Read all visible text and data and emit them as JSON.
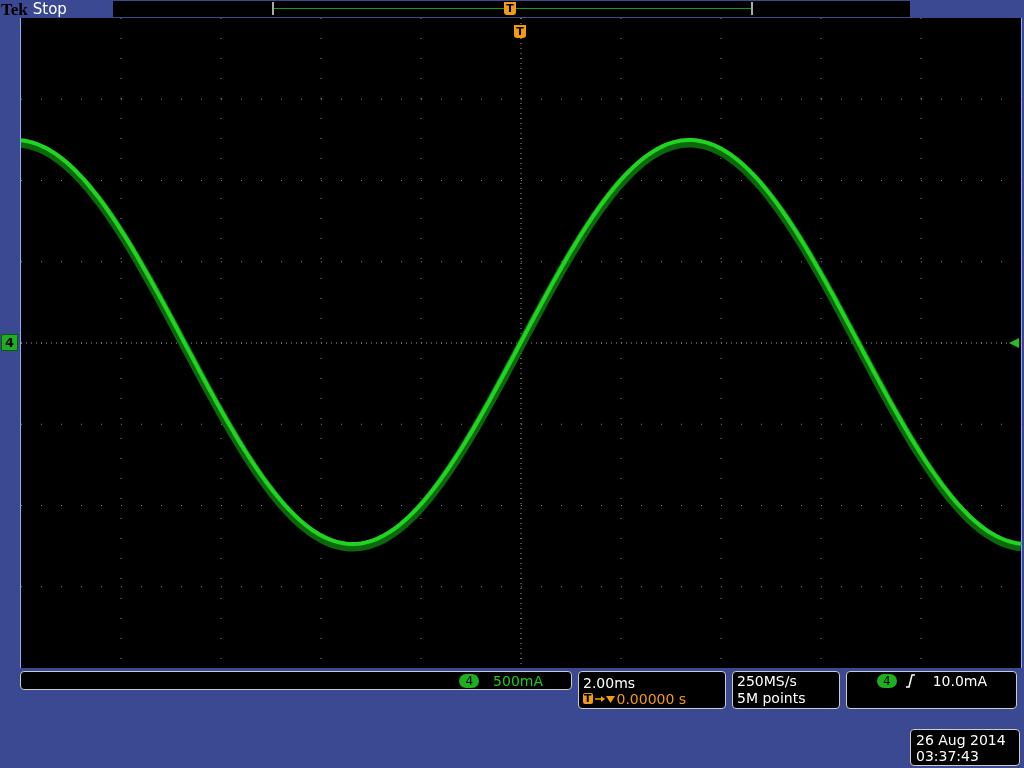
{
  "brand": "Tek",
  "status": "Stop",
  "record_view": {
    "trigger_marker": "T"
  },
  "graticule": {
    "trigger_marker": "T",
    "channel_marker": "4"
  },
  "vertical": {
    "channel": "4",
    "scale": "500mA"
  },
  "horizontal": {
    "scale": "2.00ms",
    "trigger_badge": "T",
    "position": "0.00000 s"
  },
  "acquisition": {
    "sample_rate": "250MS/s",
    "record_length": "5M points"
  },
  "trigger": {
    "channel": "4",
    "reading": "10.0mA"
  },
  "datetime": {
    "date": "26 Aug 2014",
    "time": "03:37:43"
  }
}
